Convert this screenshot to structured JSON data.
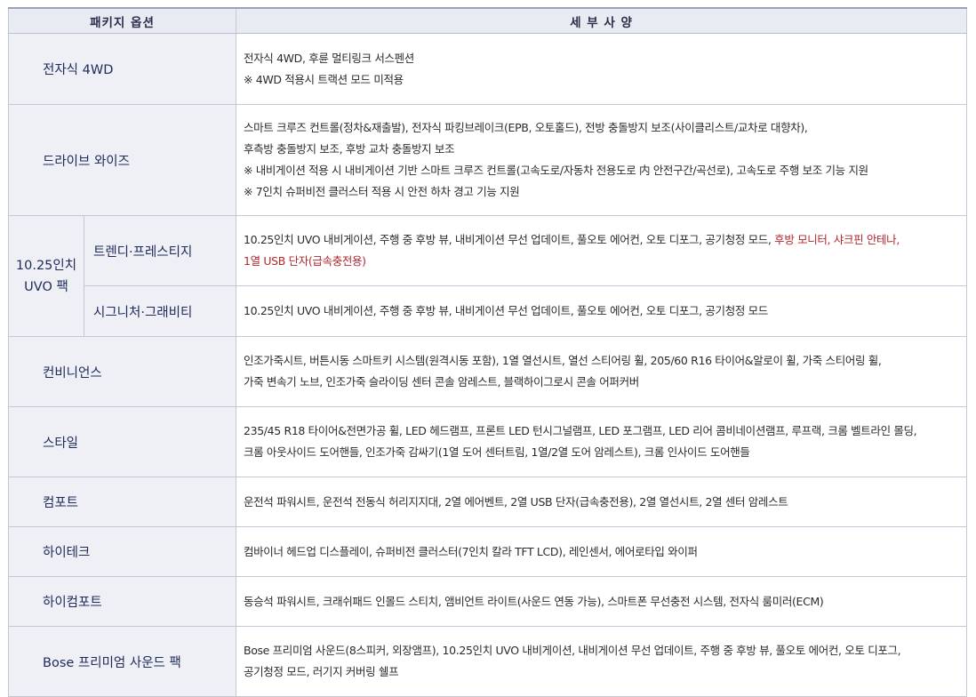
{
  "header": {
    "col_package": "패키지 옵션",
    "col_detail": "세 부 사 양"
  },
  "rows": [
    {
      "name": "전자식 4WD",
      "lines": [
        "전자식 4WD, 후륜 멀티링크 서스펜션",
        "※ 4WD 적용시 트랙션 모드 미적용"
      ]
    },
    {
      "name": "드라이브 와이즈",
      "lines": [
        "스마트 크루즈 컨트롤(정차&재출발), 전자식 파킹브레이크(EPB, 오토홀드), 전방 충돌방지 보조(사이클리스트/교차로 대향차),",
        "후측방 충돌방지 보조, 후방 교차 충돌방지 보조",
        "※ 내비게이션 적용 시 내비게이션 기반 스마트 크루즈 컨트롤(고속도로/자동차 전용도로 内 안전구간/곡선로), 고속도로 주행 보조 기능 지원",
        "※  7인치 슈퍼비전 클러스터 적용 시 안전 하차 경고 기능 지원"
      ]
    },
    {
      "group_line1": "10.25인치",
      "group_line2": "UVO 팩",
      "trims": [
        {
          "name": "트렌디·프레스티지",
          "line1_plain": "10.25인치 UVO 내비게이션, 주행 중 후방 뷰, 내비게이션 무선 업데이트, 풀오토 에어컨, 오토 디포그, 공기청정 모드, ",
          "line1_red": "후방 모니터, 샤크핀 안테나,",
          "line2_red": "1열 USB 단자(급속충전용)"
        },
        {
          "name": "시그니처·그래비티",
          "line1_plain": "10.25인치 UVO 내비게이션, 주행 중 후방 뷰, 내비게이션 무선 업데이트, 풀오토 에어컨, 오토 디포그, 공기청정 모드"
        }
      ]
    },
    {
      "name": "컨비니언스",
      "lines": [
        "인조가죽시트, 버튼시동 스마트키 시스템(원격시동 포함), 1열 열선시트, 열선 스티어링 휠, 205/60 R16 타이어&알로이 휠, 가죽 스티어링 휠,",
        "가죽 변속기 노브, 인조가죽 슬라이딩 센터 콘솔 암레스트, 블랙하이그로시 콘솔 어퍼커버"
      ]
    },
    {
      "name": "스타일",
      "lines": [
        "235/45 R18 타이어&전면가공 휠, LED 헤드램프, 프론트 LED 턴시그널램프, LED 포그램프, LED 리어 콤비네이션램프, 루프랙, 크롬 벨트라인 몰딩,",
        "크롬 아웃사이드 도어핸들, 인조가죽 감싸기(1열 도어 센터트림, 1열/2열 도어 암레스트), 크롬 인사이드 도어핸들"
      ]
    },
    {
      "name": "컴포트",
      "lines": [
        "운전석 파워시트, 운전석 전동식 허리지지대, 2열 에어벤트, 2열 USB 단자(급속충전용), 2열 열선시트, 2열 센터 암레스트"
      ]
    },
    {
      "name": "하이테크",
      "lines": [
        "컴바이너 헤드업 디스플레이, 슈퍼비전 클러스터(7인치 칼라 TFT LCD), 레인센서, 에어로타입 와이퍼"
      ]
    },
    {
      "name": "하이컴포트",
      "lines": [
        "동승석 파워시트, 크래쉬패드 인몰드 스티치, 앰비언트 라이트(사운드 연동 가능), 스마트폰 무선충전 시스템, 전자식 룸미러(ECM)"
      ]
    },
    {
      "name": "Bose 프리미엄 사운드 팩",
      "lines": [
        "Bose 프리미엄 사운드(8스피커, 외장앰프), 10.25인치 UVO 내비게이션, 내비게이션 무선 업데이트, 주행 중 후방 뷰, 풀오토 에어컨, 오토 디포그,",
        "공기청정 모드, 러기지 커버링 쉘프"
      ]
    }
  ]
}
